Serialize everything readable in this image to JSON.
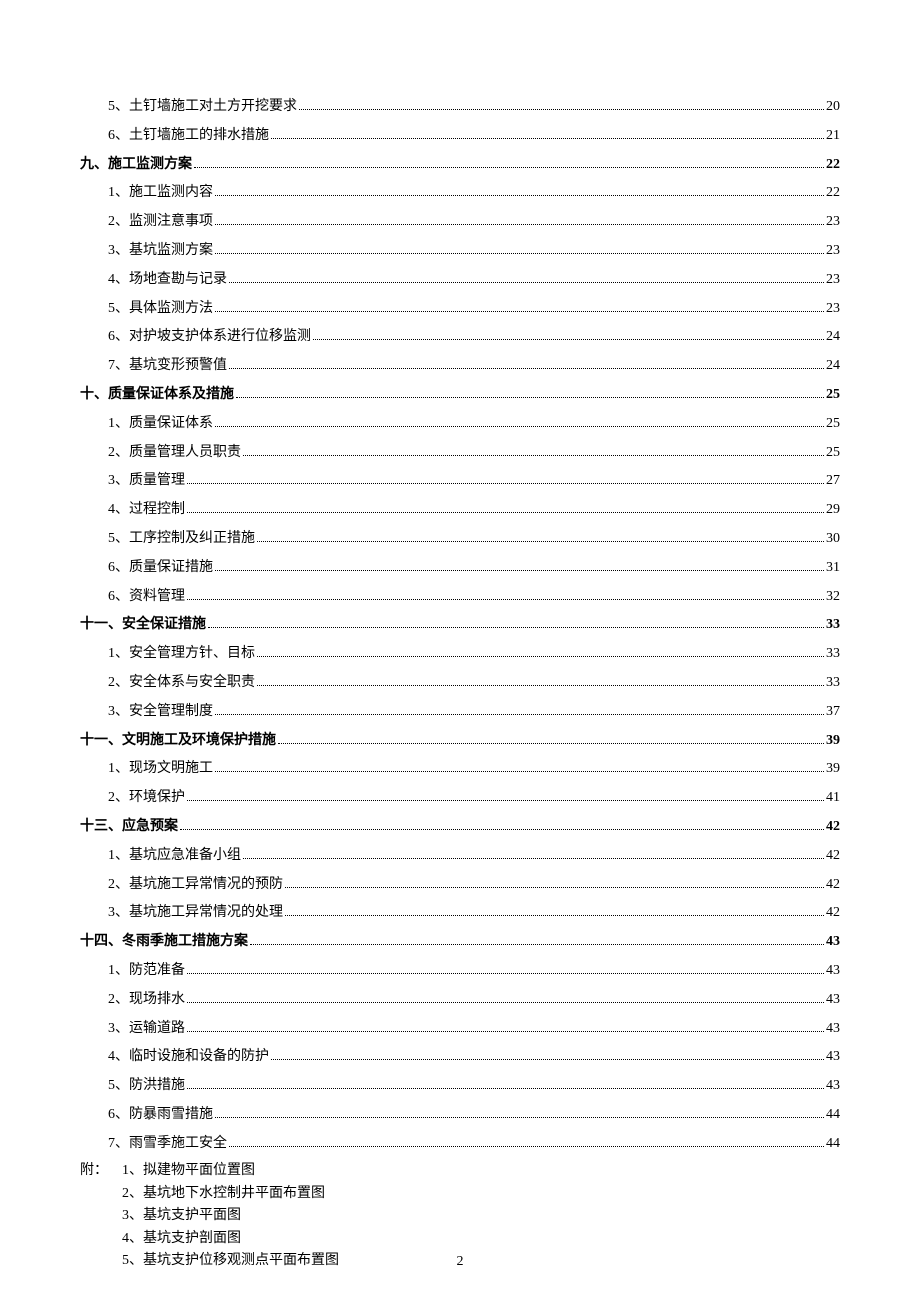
{
  "toc": [
    {
      "level": "sub",
      "label": "5、土钉墙施工对土方开挖要求",
      "page": "20"
    },
    {
      "level": "sub",
      "label": "6、土钉墙施工的排水措施",
      "page": "21"
    },
    {
      "level": "h1",
      "label": "九、施工监测方案",
      "page": "22"
    },
    {
      "level": "sub",
      "label": "1、施工监测内容",
      "page": "22"
    },
    {
      "level": "sub",
      "label": "2、监测注意事项",
      "page": "23"
    },
    {
      "level": "sub",
      "label": "3、基坑监测方案",
      "page": "23"
    },
    {
      "level": "sub",
      "label": "4、场地查勘与记录",
      "page": "23"
    },
    {
      "level": "sub",
      "label": "5、具体监测方法",
      "page": "23"
    },
    {
      "level": "sub",
      "label": "6、对护坡支护体系进行位移监测",
      "page": "24"
    },
    {
      "level": "sub",
      "label": "7、基坑变形预警值",
      "page": "24"
    },
    {
      "level": "h1",
      "label": "十、质量保证体系及措施",
      "page": "25"
    },
    {
      "level": "sub",
      "label": "1、质量保证体系",
      "page": "25"
    },
    {
      "level": "sub",
      "label": "2、质量管理人员职责",
      "page": "25"
    },
    {
      "level": "sub",
      "label": "3、质量管理",
      "page": "27"
    },
    {
      "level": "sub",
      "label": "4、过程控制",
      "page": "29"
    },
    {
      "level": "sub",
      "label": "5、工序控制及纠正措施",
      "page": "30"
    },
    {
      "level": "sub",
      "label": "6、质量保证措施",
      "page": "31"
    },
    {
      "level": "sub",
      "label": "6、资料管理",
      "page": "32"
    },
    {
      "level": "h1",
      "label": "十一、安全保证措施",
      "page": "33"
    },
    {
      "level": "sub",
      "label": "1、安全管理方针、目标",
      "page": "33"
    },
    {
      "level": "sub",
      "label": "2、安全体系与安全职责",
      "page": "33"
    },
    {
      "level": "sub",
      "label": "3、安全管理制度",
      "page": "37"
    },
    {
      "level": "h1",
      "label": "十一、文明施工及环境保护措施",
      "page": "39"
    },
    {
      "level": "sub",
      "label": "1、现场文明施工",
      "page": "39"
    },
    {
      "level": "sub",
      "label": "2、环境保护",
      "page": "41"
    },
    {
      "level": "h1",
      "label": "十三、应急预案",
      "page": "42"
    },
    {
      "level": "sub",
      "label": "1、基坑应急准备小组",
      "page": "42"
    },
    {
      "level": "sub",
      "label": "2、基坑施工异常情况的预防",
      "page": "42"
    },
    {
      "level": "sub",
      "label": "3、基坑施工异常情况的处理",
      "page": "42"
    },
    {
      "level": "h1",
      "label": "十四、冬雨季施工措施方案",
      "page": "43"
    },
    {
      "level": "sub",
      "label": "1、防范准备",
      "page": "43"
    },
    {
      "level": "sub",
      "label": "2、现场排水",
      "page": "43"
    },
    {
      "level": "sub",
      "label": "3、运输道路",
      "page": "43"
    },
    {
      "level": "sub",
      "label": "4、临时设施和设备的防护",
      "page": "43"
    },
    {
      "level": "sub",
      "label": "5、防洪措施",
      "page": "43"
    },
    {
      "level": "sub",
      "label": "6、防暴雨雪措施",
      "page": "44"
    },
    {
      "level": "sub",
      "label": "7、雨雪季施工安全",
      "page": "44"
    }
  ],
  "attach": {
    "prefix": "附：",
    "items": [
      "1、拟建物平面位置图",
      "2、基坑地下水控制井平面布置图",
      "3、基坑支护平面图",
      "4、基坑支护剖面图",
      "5、基坑支护位移观测点平面布置图"
    ]
  },
  "page_number": "2"
}
